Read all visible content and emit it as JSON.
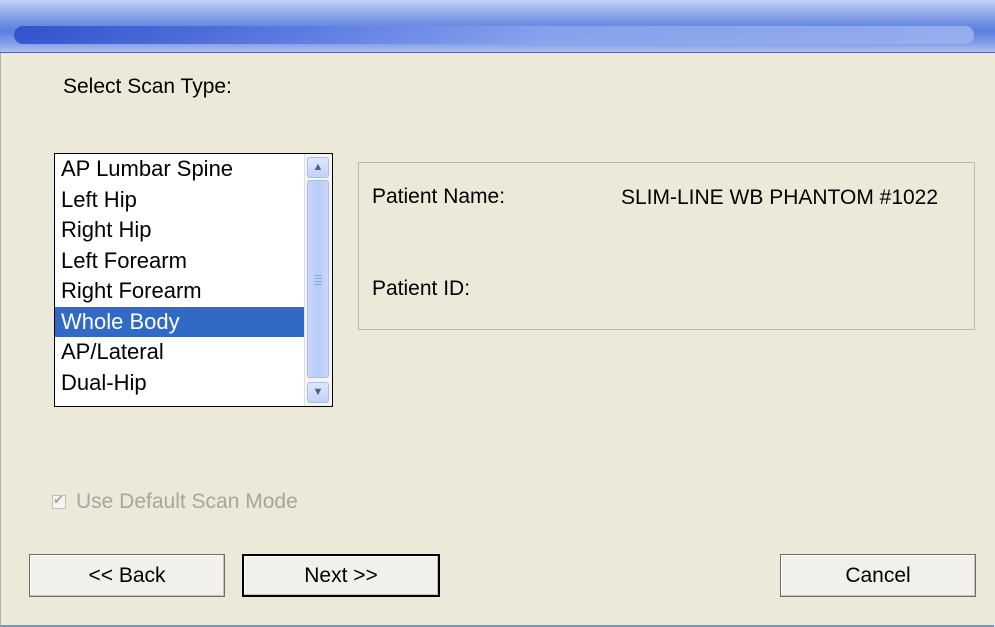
{
  "dialog": {
    "heading": "Select Scan Type:"
  },
  "scan_types": {
    "items": [
      "AP Lumbar Spine",
      "Left Hip",
      "Right Hip",
      "Left Forearm",
      "Right Forearm",
      "Whole Body",
      "AP/Lateral",
      "Dual-Hip"
    ],
    "selected": "Whole Body"
  },
  "patient": {
    "name_label": "Patient Name:",
    "name_value": "SLIM-LINE WB PHANTOM #1022",
    "id_label": "Patient ID:",
    "id_value": ""
  },
  "options": {
    "default_scan_mode_label": "Use Default Scan Mode",
    "default_scan_mode_checked": true,
    "default_scan_mode_enabled": false
  },
  "buttons": {
    "back": "<< Back",
    "next": "Next >>",
    "cancel": "Cancel"
  },
  "colors": {
    "dialog_bg": "#ece9d8",
    "selection": "#316ac5",
    "disabled_text": "#a6a6a0"
  },
  "icons": {
    "scroll_up": "scroll-up-arrow-icon",
    "scroll_down": "scroll-down-arrow-icon",
    "check": "checkmark-icon"
  }
}
